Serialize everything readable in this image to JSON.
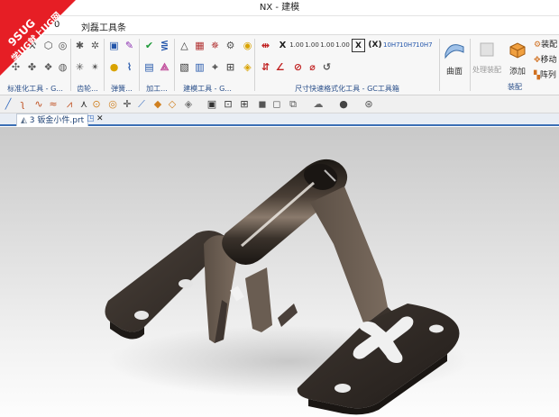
{
  "window": {
    "title": "NX - 建模"
  },
  "menu": {
    "items": [
      "0",
      "刘磊工具条"
    ]
  },
  "badge": {
    "line1": "9SUG",
    "line2": "学UG就上UG网"
  },
  "ribbon": {
    "groups": [
      {
        "label": "标准化工具 - G..."
      },
      {
        "label": "齿轮..."
      },
      {
        "label": "弹簧..."
      },
      {
        "label": "加工..."
      },
      {
        "label": "建模工具 - G..."
      },
      {
        "label": "尺寸快速格式化工具 - GC工具箱"
      },
      {
        "label": "装配"
      }
    ],
    "dim_icons": [
      "X",
      "1.00",
      "1.00",
      "1.00",
      "1.00",
      "(X)",
      "10H7",
      "10H7",
      "10H7"
    ],
    "dim_icons_row2": [
      "⊘",
      "⌀",
      "↺"
    ],
    "surface_label": "曲面",
    "process_label": "处理装配",
    "add_label": "添加",
    "assembly_items": [
      "装配",
      "移动",
      "阵列"
    ]
  },
  "document": {
    "tab_label": "3 钣金小件.prt"
  },
  "colors": {
    "accent": "#3b6fb5",
    "metal_dark": "#2c2622",
    "metal_mid": "#5b4f45",
    "metal_light": "#8a7a6c",
    "badge_red": "#e61e25"
  }
}
